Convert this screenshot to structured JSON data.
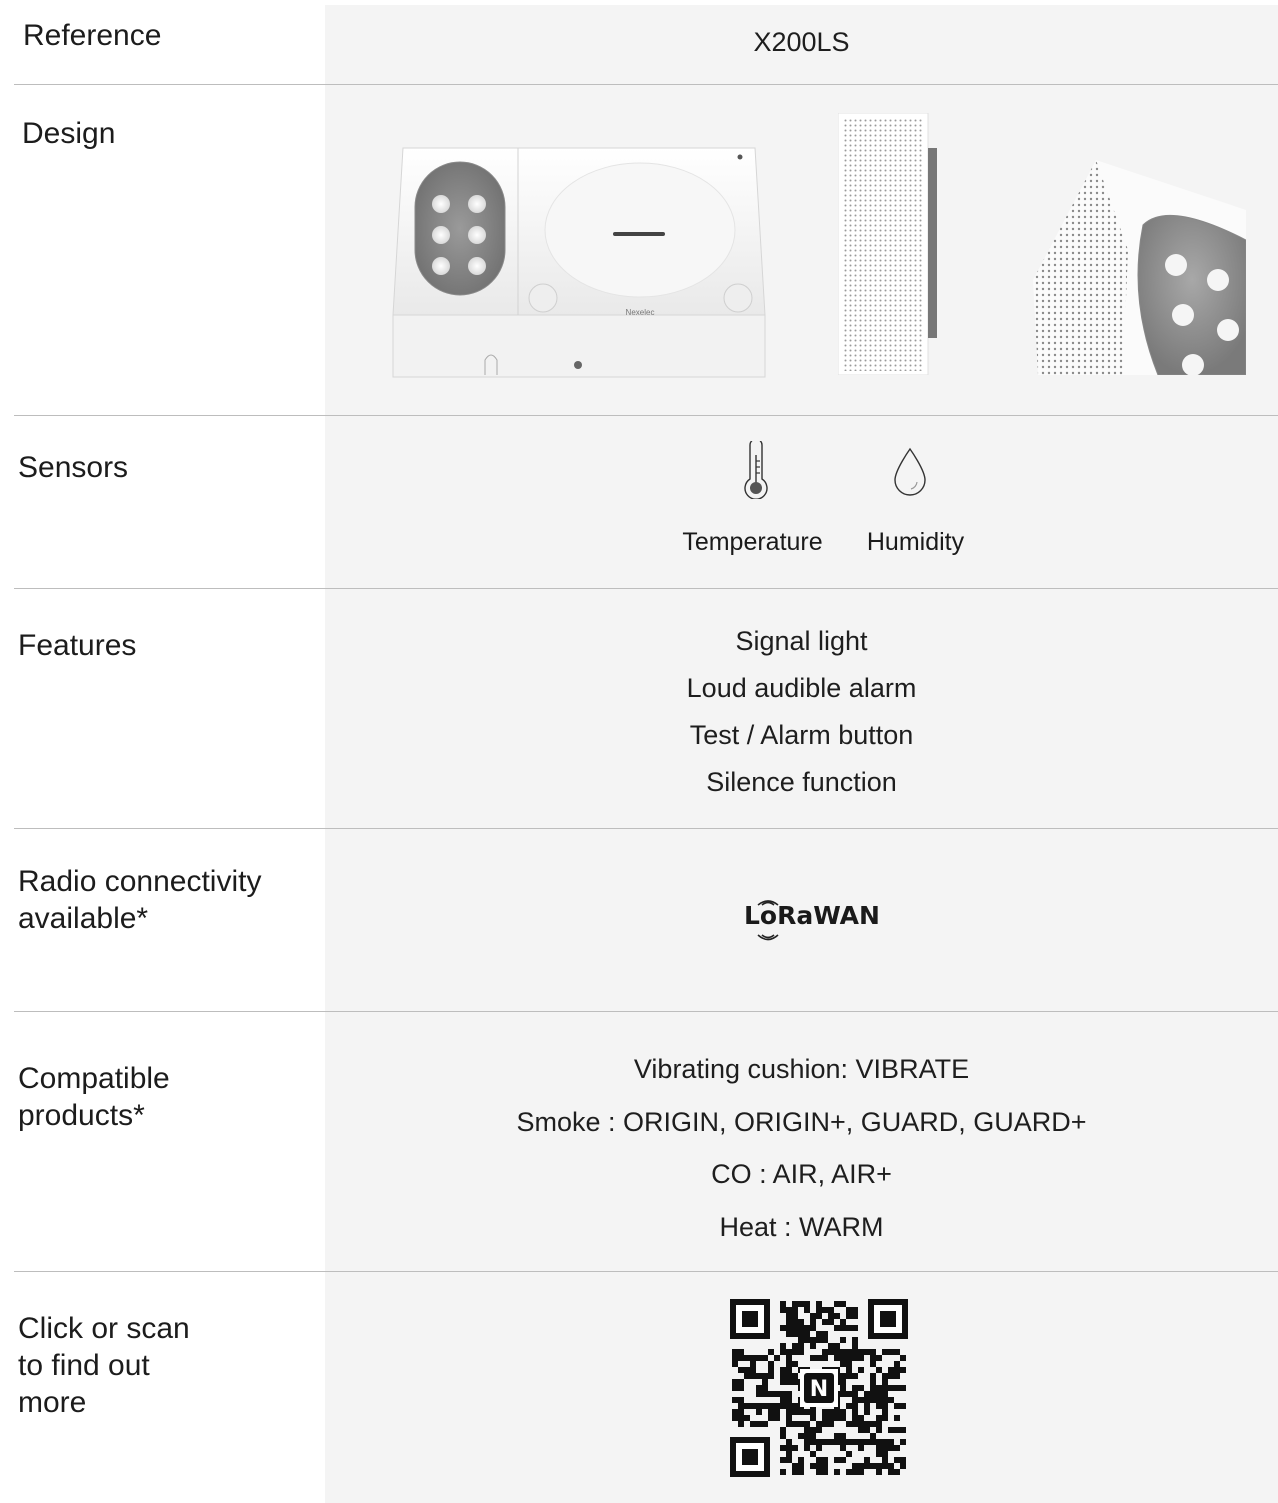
{
  "rows": {
    "reference": {
      "label": "Reference",
      "value": "X200LS"
    },
    "design": {
      "label": "Design",
      "brand_mark": "Nexelec"
    },
    "sensors": {
      "label": "Sensors",
      "items": [
        {
          "icon": "thermometer-icon",
          "label": "Temperature"
        },
        {
          "icon": "droplet-icon",
          "label": "Humidity"
        }
      ]
    },
    "features": {
      "label": "Features",
      "items": [
        "Signal light",
        "Loud audible alarm",
        "Test / Alarm button",
        "Silence function"
      ]
    },
    "radio": {
      "label_line1": "Radio connectivity",
      "label_line2": "available*",
      "logo_text": "LoRaWAN"
    },
    "compatible": {
      "label_line1": "Compatible",
      "label_line2": "products*",
      "items": [
        "Vibrating cushion: VIBRATE",
        "Smoke : ORIGIN, ORIGIN+, GUARD, GUARD+",
        "CO : AIR, AIR+",
        "Heat : WARM"
      ]
    },
    "qr": {
      "label_line1": "Click or scan",
      "label_line2": "to find out",
      "label_line3": "more",
      "qr_center_letter": "N"
    }
  }
}
